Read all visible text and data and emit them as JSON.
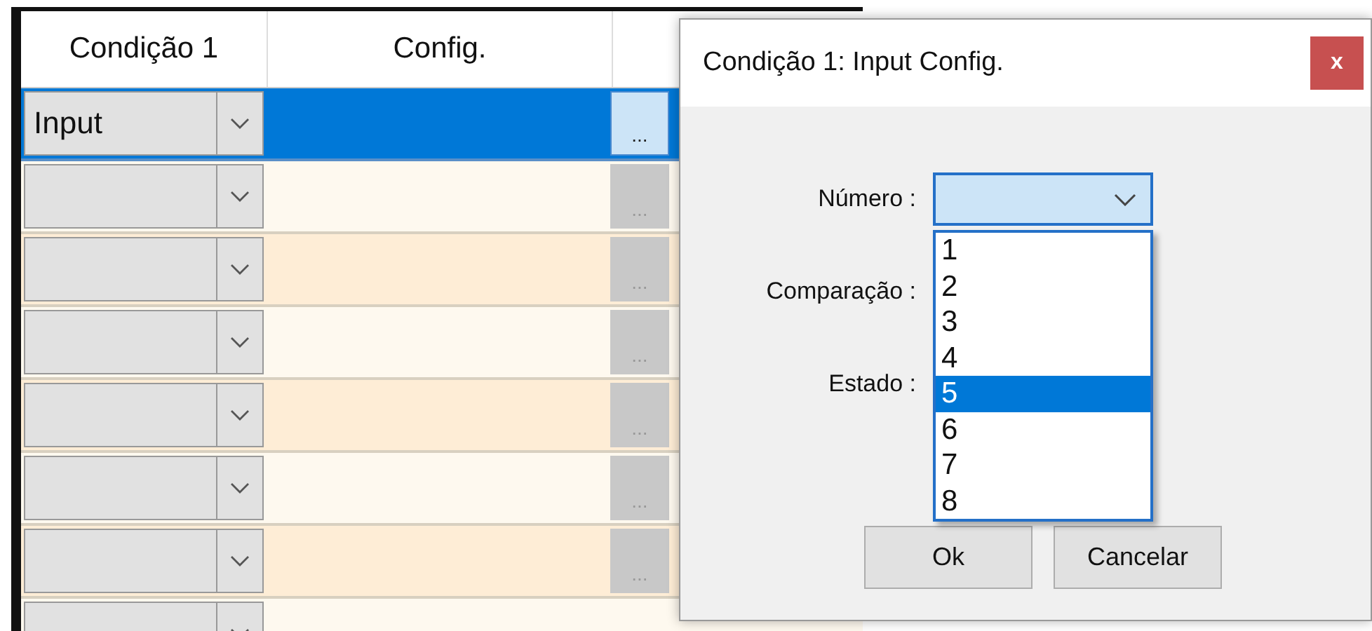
{
  "grid": {
    "columns": [
      "Condição 1",
      "Config."
    ],
    "rows": [
      {
        "selected": true,
        "value": "Input",
        "button": "..."
      },
      {
        "selected": false,
        "button": "..."
      },
      {
        "selected": false,
        "button": "..."
      },
      {
        "selected": false,
        "button": "..."
      },
      {
        "selected": false,
        "button": "..."
      },
      {
        "selected": false,
        "button": "..."
      },
      {
        "selected": false,
        "button": "..."
      },
      {
        "selected": false
      }
    ]
  },
  "dialog": {
    "title": "Condição 1: Input Config.",
    "close": "x",
    "fields": [
      {
        "label": "Número :",
        "kind": "combo"
      },
      {
        "label": "Comparação :",
        "kind": "label"
      },
      {
        "label": "Estado :",
        "kind": "label"
      }
    ],
    "dropdown": [
      {
        "label": "1",
        "selected": false
      },
      {
        "label": "2",
        "selected": false
      },
      {
        "label": "3",
        "selected": false
      },
      {
        "label": "4",
        "selected": false
      },
      {
        "label": "5",
        "selected": true
      },
      {
        "label": "6",
        "selected": false
      },
      {
        "label": "7",
        "selected": false
      },
      {
        "label": "8",
        "selected": false
      }
    ],
    "buttons": [
      "Ok",
      "Cancelar"
    ]
  }
}
